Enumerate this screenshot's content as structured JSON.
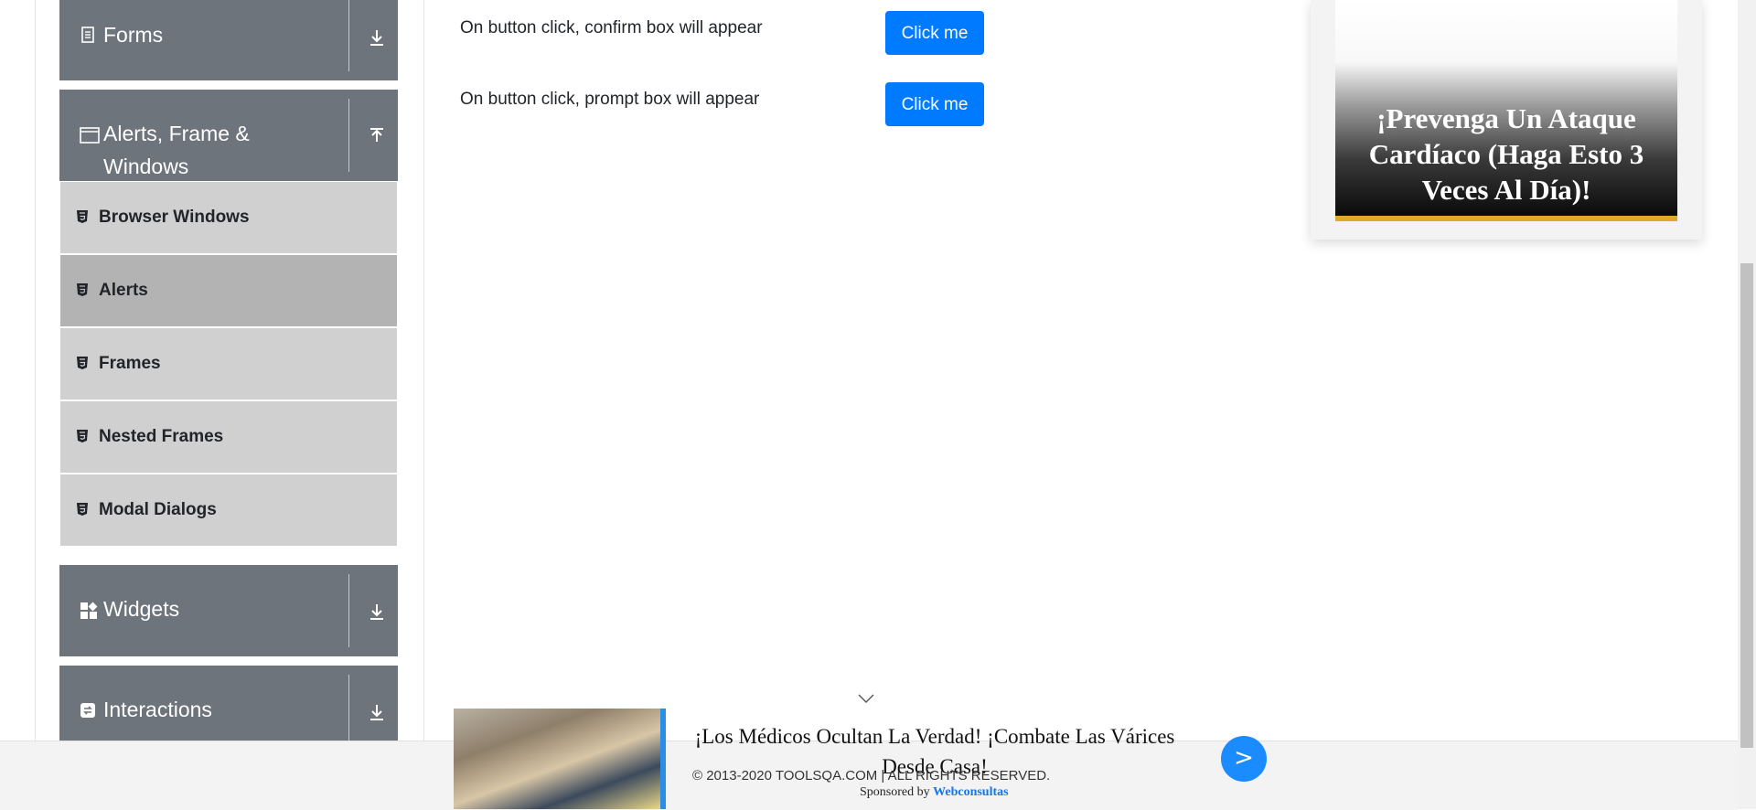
{
  "sidebar": {
    "groups": [
      {
        "title": "Forms",
        "icon": "document-icon",
        "arrow": "download-arrow-icon"
      },
      {
        "title": "Alerts, Frame & Windows",
        "icon": "window-icon",
        "arrow": "upload-arrow-icon"
      },
      {
        "title": "Widgets",
        "icon": "widgets-icon",
        "arrow": "download-arrow-icon"
      },
      {
        "title": "Interactions",
        "icon": "interactions-icon",
        "arrow": "download-arrow-icon"
      }
    ],
    "items": [
      {
        "label": "Browser Windows",
        "active": false
      },
      {
        "label": "Alerts",
        "active": true
      },
      {
        "label": "Frames",
        "active": false
      },
      {
        "label": "Nested Frames",
        "active": false
      },
      {
        "label": "Modal Dialogs",
        "active": false
      }
    ]
  },
  "main": {
    "rows": [
      {
        "text": "On button click, confirm box will appear",
        "button": "Click me"
      },
      {
        "text": "On button click, prompt box will appear",
        "button": "Click me"
      }
    ]
  },
  "ad_right": {
    "headline": "¡Prevenga Un Ataque Cardíaco (Haga Esto 3 Veces Al Día)!"
  },
  "ad_bottom": {
    "headline": "¡Los Médicos Ocultan La Verdad! ¡Combate Las Várices Desde Casa!",
    "go_label": ">"
  },
  "footer": {
    "copyright": "© 2013-2020 TOOLSQA.COM | ALL RIGHTS RESERVED.",
    "sponsored_prefix": "Sponsored by",
    "sponsor_name": "Webconsultas"
  },
  "colors": {
    "sidebar_header": "#6d747c",
    "menu_item": "#d0d0d0",
    "menu_item_active": "#b3b3b3",
    "primary_button": "#007bff"
  }
}
